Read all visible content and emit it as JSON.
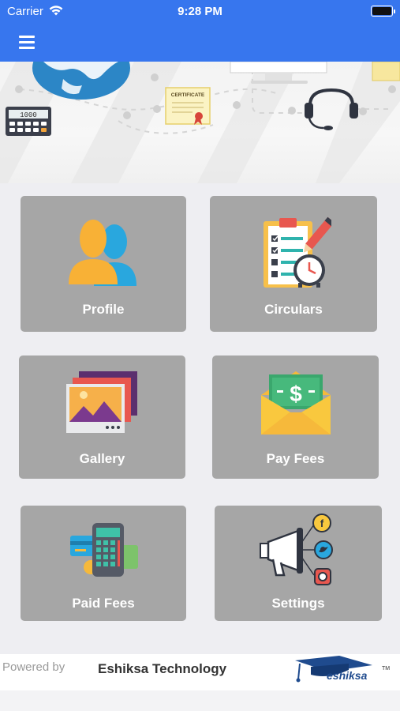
{
  "status_bar": {
    "carrier": "Carrier",
    "time": "9:28 PM"
  },
  "nav": {
    "menu_icon": "hamburger-menu-icon"
  },
  "banner": {
    "certificate_text": "CERTIFICATE",
    "calculator_display": "1000",
    "icons": [
      "globe-icon",
      "calculator-icon",
      "certificate-icon",
      "headset-icon",
      "monitor-icon"
    ]
  },
  "tiles": [
    {
      "label": "Profile",
      "icon": "users-icon"
    },
    {
      "label": "Circulars",
      "icon": "clipboard-clock-icon"
    },
    {
      "label": "Gallery",
      "icon": "photos-icon"
    },
    {
      "label": "Pay Fees",
      "icon": "money-envelope-icon"
    },
    {
      "label": "Paid Fees",
      "icon": "payment-calculator-icon"
    },
    {
      "label": "Settings",
      "icon": "megaphone-social-icon"
    }
  ],
  "footer": {
    "powered_by": "Powered by",
    "company": "Eshiksa Technology",
    "logo_text": "eshiksa",
    "logo_tm": "TM"
  },
  "colors": {
    "header": "#3776ee",
    "tile": "#a6a6a6"
  }
}
